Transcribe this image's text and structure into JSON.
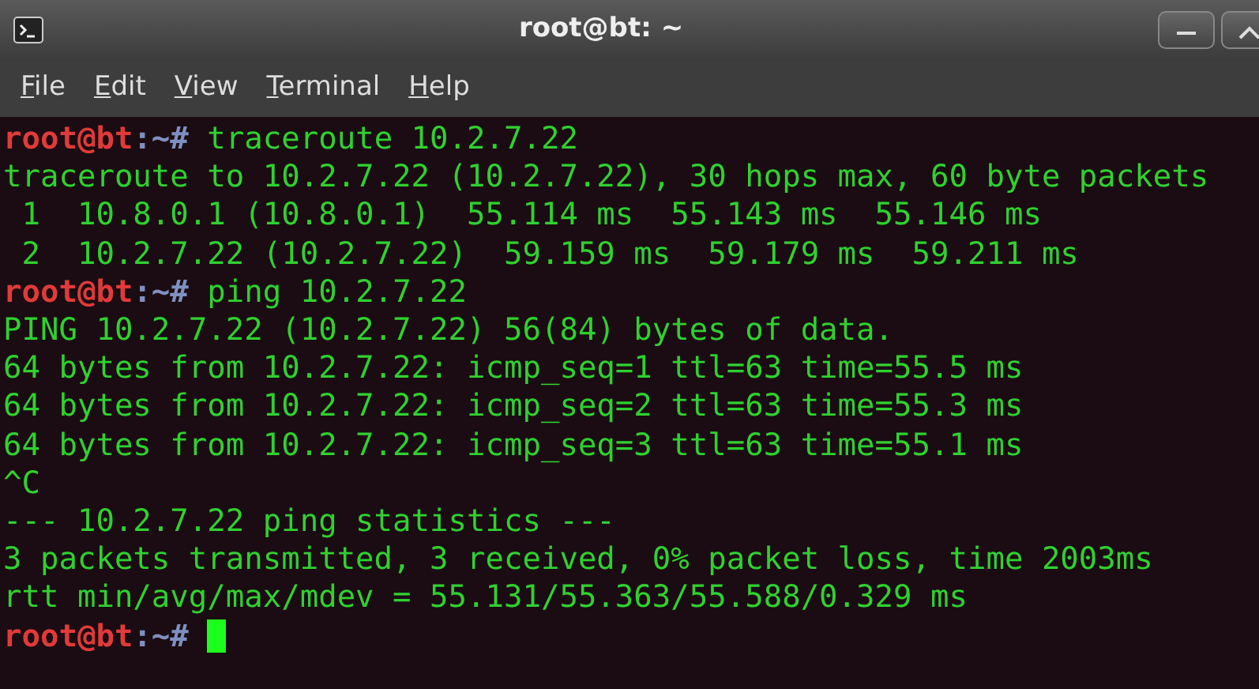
{
  "window": {
    "title": "root@bt: ~"
  },
  "menu": [
    {
      "label": "File"
    },
    {
      "label": "Edit"
    },
    {
      "label": "View"
    },
    {
      "label": "Terminal"
    },
    {
      "label": "Help"
    }
  ],
  "terminal": {
    "lines": [
      {
        "kind": "prompt",
        "user_host": "root@bt",
        "path": ":~#",
        "command": "traceroute 10.2.7.22",
        "cursor": false
      },
      {
        "kind": "output",
        "text": "traceroute to 10.2.7.22 (10.2.7.22), 30 hops max, 60 byte packets"
      },
      {
        "kind": "output",
        "text": " 1  10.8.0.1 (10.8.0.1)  55.114 ms  55.143 ms  55.146 ms"
      },
      {
        "kind": "output",
        "text": " 2  10.2.7.22 (10.2.7.22)  59.159 ms  59.179 ms  59.211 ms"
      },
      {
        "kind": "prompt",
        "user_host": "root@bt",
        "path": ":~#",
        "command": "ping 10.2.7.22",
        "cursor": false
      },
      {
        "kind": "output",
        "text": "PING 10.2.7.22 (10.2.7.22) 56(84) bytes of data."
      },
      {
        "kind": "output",
        "text": "64 bytes from 10.2.7.22: icmp_seq=1 ttl=63 time=55.5 ms"
      },
      {
        "kind": "output",
        "text": "64 bytes from 10.2.7.22: icmp_seq=2 ttl=63 time=55.3 ms"
      },
      {
        "kind": "output",
        "text": "64 bytes from 10.2.7.22: icmp_seq=3 ttl=63 time=55.1 ms"
      },
      {
        "kind": "output",
        "text": "^C"
      },
      {
        "kind": "output",
        "text": "--- 10.2.7.22 ping statistics ---"
      },
      {
        "kind": "output",
        "text": "3 packets transmitted, 3 received, 0% packet loss, time 2003ms"
      },
      {
        "kind": "output",
        "text": "rtt min/avg/max/mdev = 55.131/55.363/55.588/0.329 ms"
      },
      {
        "kind": "prompt",
        "user_host": "root@bt",
        "path": ":~#",
        "cursor": true
      }
    ]
  }
}
